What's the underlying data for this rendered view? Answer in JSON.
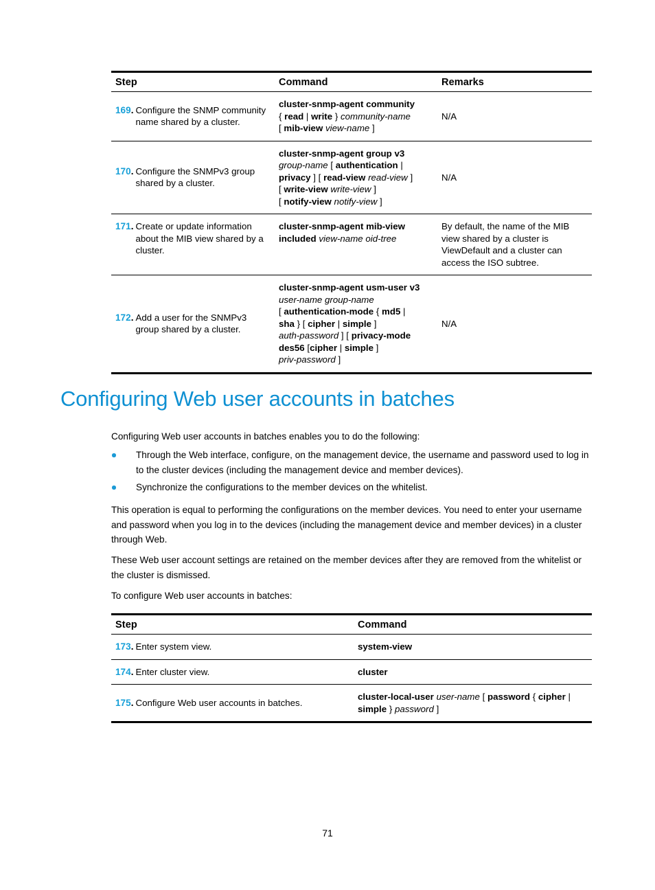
{
  "page": {
    "number": "71"
  },
  "colors": {
    "accent_blue": "#18A0D8",
    "heading_blue": "#0E90D2",
    "bullet_blue": "#1B9AD6",
    "rule_black": "#000000"
  },
  "table_snmp": {
    "headers": {
      "step": "Step",
      "command": "Command",
      "remarks": "Remarks"
    },
    "rows": [
      {
        "num": "169.",
        "step": "Configure the SNMP community name shared by a cluster.",
        "command_parts": [
          {
            "t": "cluster-snmp-agent community",
            "s": "b"
          },
          {
            "t": "\n",
            "s": "br"
          },
          {
            "t": "{ ",
            "s": "n"
          },
          {
            "t": "read",
            "s": "b"
          },
          {
            "t": " | ",
            "s": "n"
          },
          {
            "t": "write",
            "s": "b"
          },
          {
            "t": " } ",
            "s": "n"
          },
          {
            "t": "community-name",
            "s": "i"
          },
          {
            "t": "\n",
            "s": "br"
          },
          {
            "t": "[ ",
            "s": "n"
          },
          {
            "t": "mib-view",
            "s": "b"
          },
          {
            "t": " ",
            "s": "n"
          },
          {
            "t": "view-name",
            "s": "i"
          },
          {
            "t": " ]",
            "s": "n"
          }
        ],
        "remarks": "N/A"
      },
      {
        "num": "170.",
        "step": "Configure the SNMPv3 group shared by a cluster.",
        "command_parts": [
          {
            "t": "cluster-snmp-agent group v3",
            "s": "b"
          },
          {
            "t": "\n",
            "s": "br"
          },
          {
            "t": "group-name",
            "s": "i"
          },
          {
            "t": " [ ",
            "s": "n"
          },
          {
            "t": "authentication",
            "s": "b"
          },
          {
            "t": " |",
            "s": "n"
          },
          {
            "t": "\n",
            "s": "br"
          },
          {
            "t": "privacy",
            "s": "b"
          },
          {
            "t": " ] [ ",
            "s": "n"
          },
          {
            "t": "read-view",
            "s": "b"
          },
          {
            "t": " ",
            "s": "n"
          },
          {
            "t": "read-view",
            "s": "i"
          },
          {
            "t": " ]",
            "s": "n"
          },
          {
            "t": "\n",
            "s": "br"
          },
          {
            "t": "[ ",
            "s": "n"
          },
          {
            "t": "write-view",
            "s": "b"
          },
          {
            "t": " ",
            "s": "n"
          },
          {
            "t": "write-view",
            "s": "i"
          },
          {
            "t": " ]",
            "s": "n"
          },
          {
            "t": "\n",
            "s": "br"
          },
          {
            "t": "[ ",
            "s": "n"
          },
          {
            "t": "notify-view",
            "s": "b"
          },
          {
            "t": " ",
            "s": "n"
          },
          {
            "t": "notify-view",
            "s": "i"
          },
          {
            "t": " ]",
            "s": "n"
          }
        ],
        "remarks": "N/A"
      },
      {
        "num": "171.",
        "step": "Create or update information about the MIB view shared by a cluster.",
        "command_parts": [
          {
            "t": "cluster-snmp-agent mib-view",
            "s": "b"
          },
          {
            "t": "\n",
            "s": "br"
          },
          {
            "t": "included",
            "s": "b"
          },
          {
            "t": " ",
            "s": "n"
          },
          {
            "t": "view-name oid-tree",
            "s": "i"
          }
        ],
        "remarks": "By default, the name of the MIB view shared by a cluster is ViewDefault and a cluster can access the ISO subtree."
      },
      {
        "num": "172.",
        "step": "Add a user for the SNMPv3 group shared by a cluster.",
        "command_parts": [
          {
            "t": "cluster-snmp-agent usm-user v3",
            "s": "b"
          },
          {
            "t": "\n",
            "s": "br"
          },
          {
            "t": "user-name group-name",
            "s": "i"
          },
          {
            "t": "\n",
            "s": "br"
          },
          {
            "t": "[ ",
            "s": "n"
          },
          {
            "t": "authentication-mode",
            "s": "b"
          },
          {
            "t": " { ",
            "s": "n"
          },
          {
            "t": "md5",
            "s": "b"
          },
          {
            "t": " |",
            "s": "n"
          },
          {
            "t": "\n",
            "s": "br"
          },
          {
            "t": "sha",
            "s": "b"
          },
          {
            "t": " } [ ",
            "s": "n"
          },
          {
            "t": "cipher",
            "s": "b"
          },
          {
            "t": " | ",
            "s": "n"
          },
          {
            "t": "simple",
            "s": "b"
          },
          {
            "t": " ]",
            "s": "n"
          },
          {
            "t": "\n",
            "s": "br"
          },
          {
            "t": "auth-password",
            "s": "i"
          },
          {
            "t": " ] [ ",
            "s": "n"
          },
          {
            "t": "privacy-mode",
            "s": "b"
          },
          {
            "t": "\n",
            "s": "br"
          },
          {
            "t": "des56",
            "s": "b"
          },
          {
            "t": " [",
            "s": "n"
          },
          {
            "t": "cipher",
            "s": "b"
          },
          {
            "t": " | ",
            "s": "n"
          },
          {
            "t": "simple",
            "s": "b"
          },
          {
            "t": " ]",
            "s": "n"
          },
          {
            "t": "\n",
            "s": "br"
          },
          {
            "t": "priv-password",
            "s": "i"
          },
          {
            "t": " ]",
            "s": "n"
          }
        ],
        "remarks": "N/A"
      }
    ]
  },
  "heading": "Configuring Web user accounts in batches",
  "intro": "Configuring Web user accounts in batches enables you to do the following:",
  "bullets": [
    "Through the Web interface, configure, on the management device, the username and password used to log in to the cluster devices (including the management device and member devices).",
    "Synchronize the configurations to the member devices on the whitelist."
  ],
  "paragraph_2": "This operation is equal to performing the configurations on the member devices. You need to enter your username and password when you log in to the devices (including the management device and member devices) in a cluster through Web.",
  "paragraph_3": "These Web user account settings are retained on the member devices after they are removed from the whitelist or the cluster is dismissed.",
  "paragraph_4": "To configure Web user accounts in batches:",
  "table_web": {
    "headers": {
      "step": "Step",
      "command": "Command"
    },
    "rows": [
      {
        "num": "173.",
        "step": "Enter system view.",
        "command_parts": [
          {
            "t": "system-view",
            "s": "b"
          }
        ]
      },
      {
        "num": "174.",
        "step": "Enter cluster view.",
        "command_parts": [
          {
            "t": "cluster",
            "s": "b"
          }
        ]
      },
      {
        "num": "175.",
        "step": "Configure Web user accounts in batches.",
        "command_parts": [
          {
            "t": "cluster-local-user",
            "s": "b"
          },
          {
            "t": " ",
            "s": "n"
          },
          {
            "t": "user-name",
            "s": "i"
          },
          {
            "t": " [ ",
            "s": "n"
          },
          {
            "t": "password",
            "s": "b"
          },
          {
            "t": " { ",
            "s": "n"
          },
          {
            "t": "cipher",
            "s": "b"
          },
          {
            "t": " |",
            "s": "n"
          },
          {
            "t": "\n",
            "s": "br"
          },
          {
            "t": "simple",
            "s": "b"
          },
          {
            "t": " } ",
            "s": "n"
          },
          {
            "t": "password",
            "s": "i"
          },
          {
            "t": " ]",
            "s": "n"
          }
        ]
      }
    ]
  }
}
